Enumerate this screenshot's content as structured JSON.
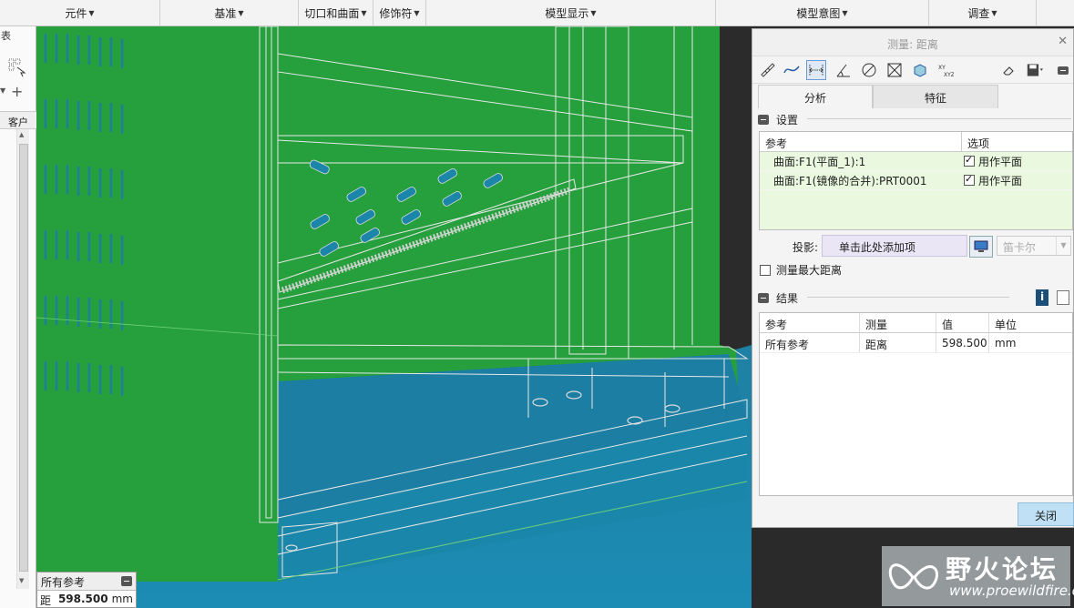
{
  "ribbon": {
    "groups": [
      {
        "label": "元件"
      },
      {
        "label": "基准"
      },
      {
        "label": "切口和曲面"
      },
      {
        "label": "修饰符"
      },
      {
        "label": "模型显示"
      },
      {
        "label": "模型意图"
      },
      {
        "label": "调查"
      }
    ]
  },
  "tree": {
    "top_label": "表",
    "column_header": "客户"
  },
  "measure_info": {
    "title": "所有参考",
    "label": "距离",
    "value": "598.500",
    "unit": "mm"
  },
  "dialog": {
    "title": "测量: 距离",
    "tabs": [
      {
        "label": "分析"
      },
      {
        "label": "特征"
      }
    ],
    "settings": {
      "heading": "设置",
      "col_ref": "参考",
      "col_opt": "选项",
      "rows": [
        {
          "ref": "曲面:F1(平面_1):1",
          "opt": "用作平面",
          "checked": true
        },
        {
          "ref": "曲面:F1(镜像的合并):PRT0001",
          "opt": "用作平面",
          "checked": true
        }
      ],
      "projection_label": "投影:",
      "projection_placeholder": "单击此处添加项",
      "coord_system": "笛卡尔",
      "max_distance_label": "测量最大距离"
    },
    "results": {
      "heading": "结果",
      "columns": [
        "参考",
        "测量",
        "值",
        "单位"
      ],
      "rows": [
        {
          "ref": "所有参考",
          "measure": "距离",
          "value": "598.500",
          "unit": "mm"
        }
      ]
    },
    "close_label": "关闭"
  },
  "watermark": {
    "title": "野火论坛",
    "url": "www.proewildfire.cn"
  },
  "colors": {
    "model_green": "#25a03c",
    "bg_top": "#1a6a8a",
    "dialog_bg": "#f4f4f4",
    "ref_table_bg": "#e9f8df",
    "arrow_red": "#e8322a"
  }
}
